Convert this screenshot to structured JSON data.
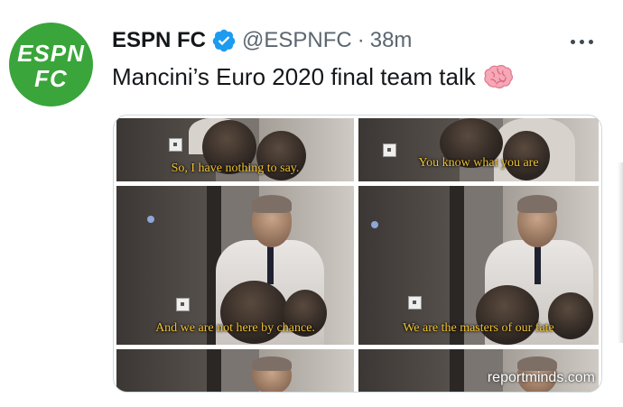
{
  "tweet": {
    "avatar": {
      "line1": "ESPN",
      "line2": "FC",
      "color": "#3aa53a"
    },
    "author_name": "ESPN FC",
    "handle": "@ESPNFC",
    "separator": "·",
    "time": "38m",
    "verified": true,
    "text": "Mancini’s Euro 2020 final team talk",
    "emoji": "brain-emoji",
    "more_icon": "more-dots-icon"
  },
  "media": {
    "subtitles": [
      "So, I have nothing to say.",
      "You know what you are",
      "And we are not here by chance.",
      "We are the masters of our fate"
    ],
    "watermark": "reportminds.com",
    "subtitle_color": "#f1c232"
  },
  "colors": {
    "text": "#14171a",
    "muted": "#5b6670",
    "verified": "#1d9bf0"
  }
}
